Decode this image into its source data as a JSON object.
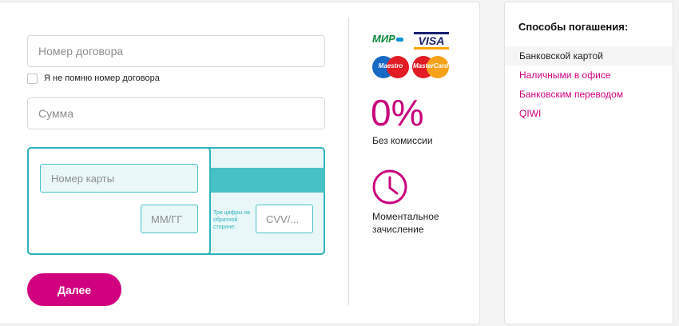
{
  "form": {
    "contract_placeholder": "Номер договора",
    "forgot_checkbox_label": "Я не помню номер договора",
    "amount_placeholder": "Сумма",
    "card_number_placeholder": "Номер карты",
    "expiry_placeholder": "ММ/ГГ",
    "cvv_hint": "Три цифры на обратной стороне:",
    "cvv_placeholder": "CVV/...",
    "submit_label": "Далее"
  },
  "payment_logos": {
    "mir": "МИР",
    "visa": "VISA",
    "maestro": "Maestro",
    "mastercard": "MasterCard"
  },
  "features": {
    "commission_value": "0%",
    "commission_label": "Без комиссии",
    "instant_label": "Моментальное зачисление",
    "clock_icon": "clock-icon"
  },
  "sidebar": {
    "title": "Способы погашения:",
    "items": [
      {
        "label": "Банковской картой",
        "active": true
      },
      {
        "label": "Наличными в офисе",
        "active": false
      },
      {
        "label": "Банковским переводом",
        "active": false
      },
      {
        "label": "QIWI",
        "active": false
      }
    ]
  },
  "colors": {
    "accent": "#d1007f",
    "card_teal": "#2fb4b9",
    "card_bg": "#e9f7f8"
  }
}
